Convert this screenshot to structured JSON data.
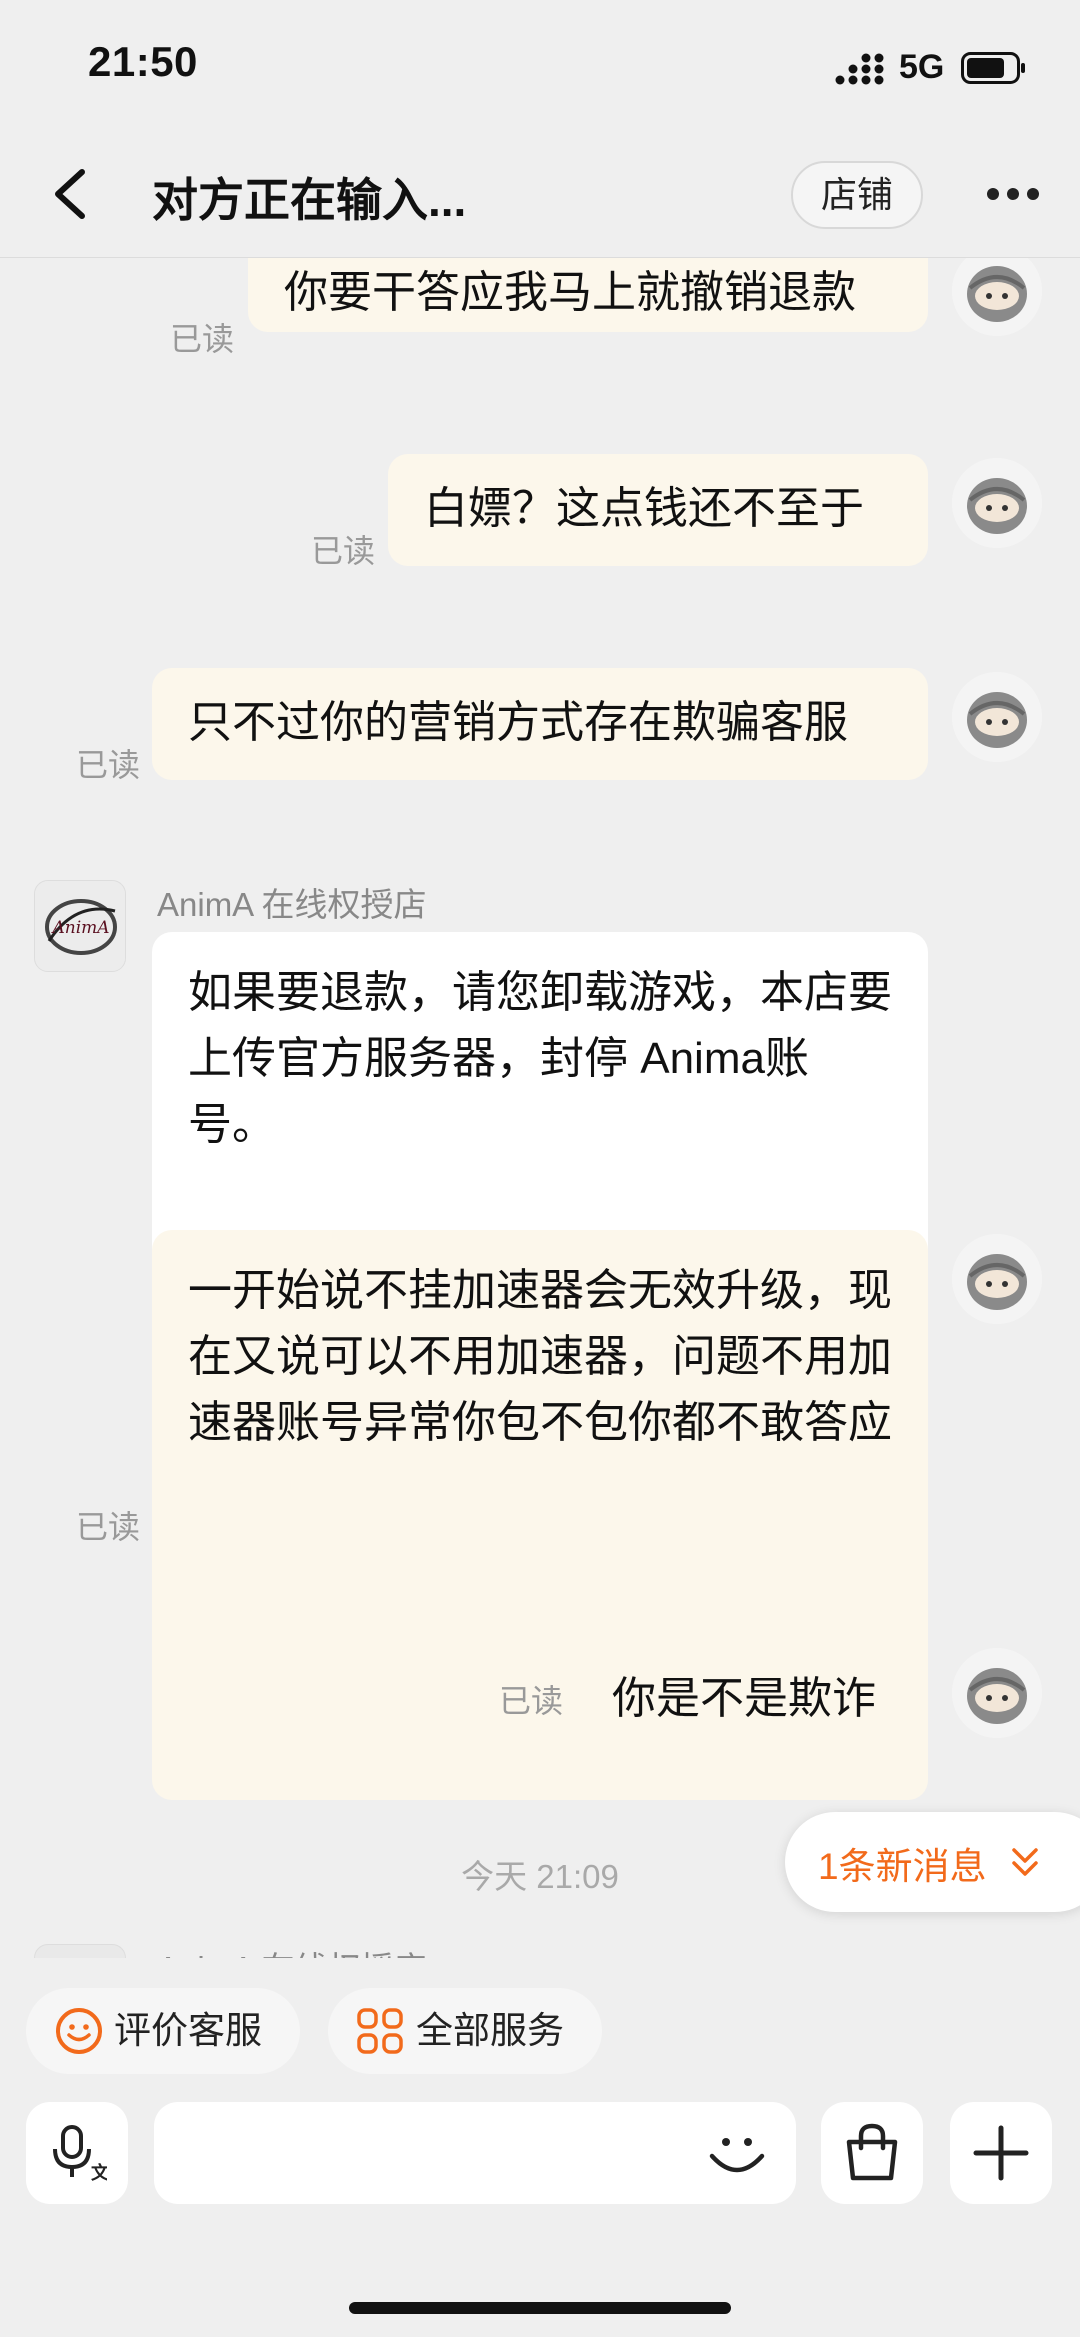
{
  "status_bar": {
    "time": "21:50",
    "network": "5G"
  },
  "header": {
    "title": "对方正在输入...",
    "shop_button": "店铺"
  },
  "messages": [
    {
      "from": "me",
      "text": "你要干答应我马上就撤销退款",
      "status": "已读"
    },
    {
      "from": "me",
      "text": "白嫖？这点钱还不至于",
      "status": "已读"
    },
    {
      "from": "me",
      "text": "只不过你的营销方式存在欺骗客服",
      "status": "已读"
    },
    {
      "from": "shop",
      "sender": "AnimA 在线权授店",
      "avatar_text": "AnimA",
      "text": "如果要退款，请您卸载游戏，本店要上传官方服务器，封停 Anima账号。"
    },
    {
      "from": "me",
      "text": "一开始说不挂加速器会无效升级，现在又说可以不用加速器，问题不用加速器账号异常你包不包你都不敢答应",
      "status": "已读"
    },
    {
      "from": "me",
      "text": "你是不是欺诈",
      "status": "已读"
    }
  ],
  "timestamp": "今天 21:09",
  "partial_sender": "AnimA 在线权授店",
  "new_message_pill": "1条新消息",
  "quick_actions": [
    {
      "label": "评价客服",
      "icon": "smile-icon"
    },
    {
      "label": "全部服务",
      "icon": "grid-icon"
    }
  ],
  "input": {
    "placeholder": ""
  },
  "colors": {
    "accent": "#f26a1b",
    "my_bubble": "#fcf7eb",
    "their_bubble": "#ffffff",
    "background": "#efefef"
  }
}
